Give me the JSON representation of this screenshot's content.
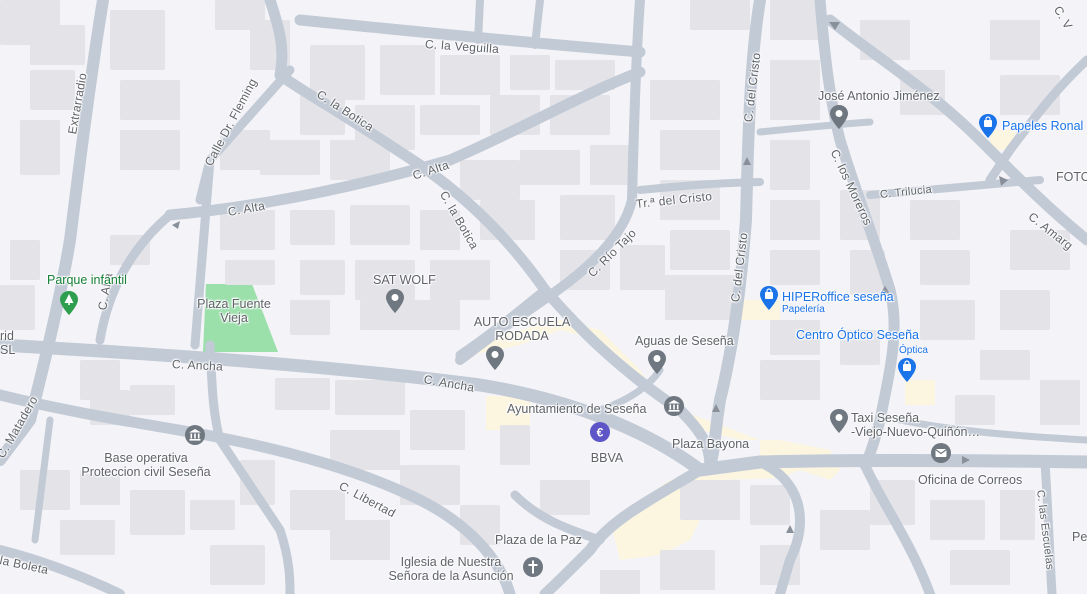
{
  "streets": {
    "veguilla": "C. la Veguilla",
    "extrarradio": "Extrarradio",
    "fleming": "Calle Dr. Fleming",
    "botica_top": "C. la Botica",
    "botica_mid": "C. la Botica",
    "alta_left": "C. Alta",
    "alta_right": "C. Alta",
    "alta_vertical": "C. Alta",
    "ancha_left": "C. Ancha",
    "ancha_right": "C. Ancha",
    "rio_tajo": "C. Río Tajo",
    "tr_cristo": "Tr.ª del Cristo",
    "cristo_top": "C. del Cristo",
    "cristo_mid": "C. del Cristo",
    "los_morenos": "C. los Moreros",
    "trilucia": "C. Trilucia",
    "amargura": "C. Amarg",
    "libertad": "C. Libertad",
    "matadero": "C. Matadero",
    "boleta": "la Boleta",
    "escuelas": "C. las Escuelas",
    "top_v": "C. V"
  },
  "places": {
    "jose_antonio": "José Antonio Jiménez",
    "papeles": "Papeles Ronal",
    "foto": "FOTO",
    "parque": "Parque infantil",
    "plaza_fuente": "Plaza Fuente\nVieja",
    "sat_wolf": "SAT WOLF",
    "auto_escuela": "AUTO ESCUELA\nRODADA",
    "hiperoffice": "HIPERoffice seseña",
    "papeleria": "Papelería",
    "centro_optico": "Centro Óptico Seseña",
    "optica": "Óptica",
    "aguas": "Aguas de Seseña",
    "ayuntamiento": "Ayuntamiento de Seseña",
    "bbva": "BBVA",
    "plaza_bayona": "Plaza Bayona",
    "taxi": "Taxi Seseña\n-Viejo-Nuevo-Quiñón…",
    "correos": "Oficina de Correos",
    "base_op": "Base operativa\nProteccion civil Seseña",
    "plaza_paz": "Plaza de la Paz",
    "iglesia": "Iglesia de Nuestra\nSeñora de la Asunción",
    "edge_left": "rid\nSL",
    "edge_right": "Pe"
  },
  "colors": {
    "background": "#f4f3f7",
    "road": "#c2cad6",
    "building": "#e3e3e8",
    "plaza": "#fcf6e1",
    "park": "#9be0ab",
    "pin_gray": "#6f7781",
    "pin_blue": "#1a73e8",
    "pin_green": "#2e9e4f",
    "pin_purple": "#5e55c7"
  },
  "icons": [
    "museum-icon",
    "shopping-bag-icon",
    "park-tree-icon",
    "place-pin-icon",
    "bank-euro-icon",
    "mail-icon",
    "church-cross-icon",
    "direction-arrow-icon"
  ]
}
